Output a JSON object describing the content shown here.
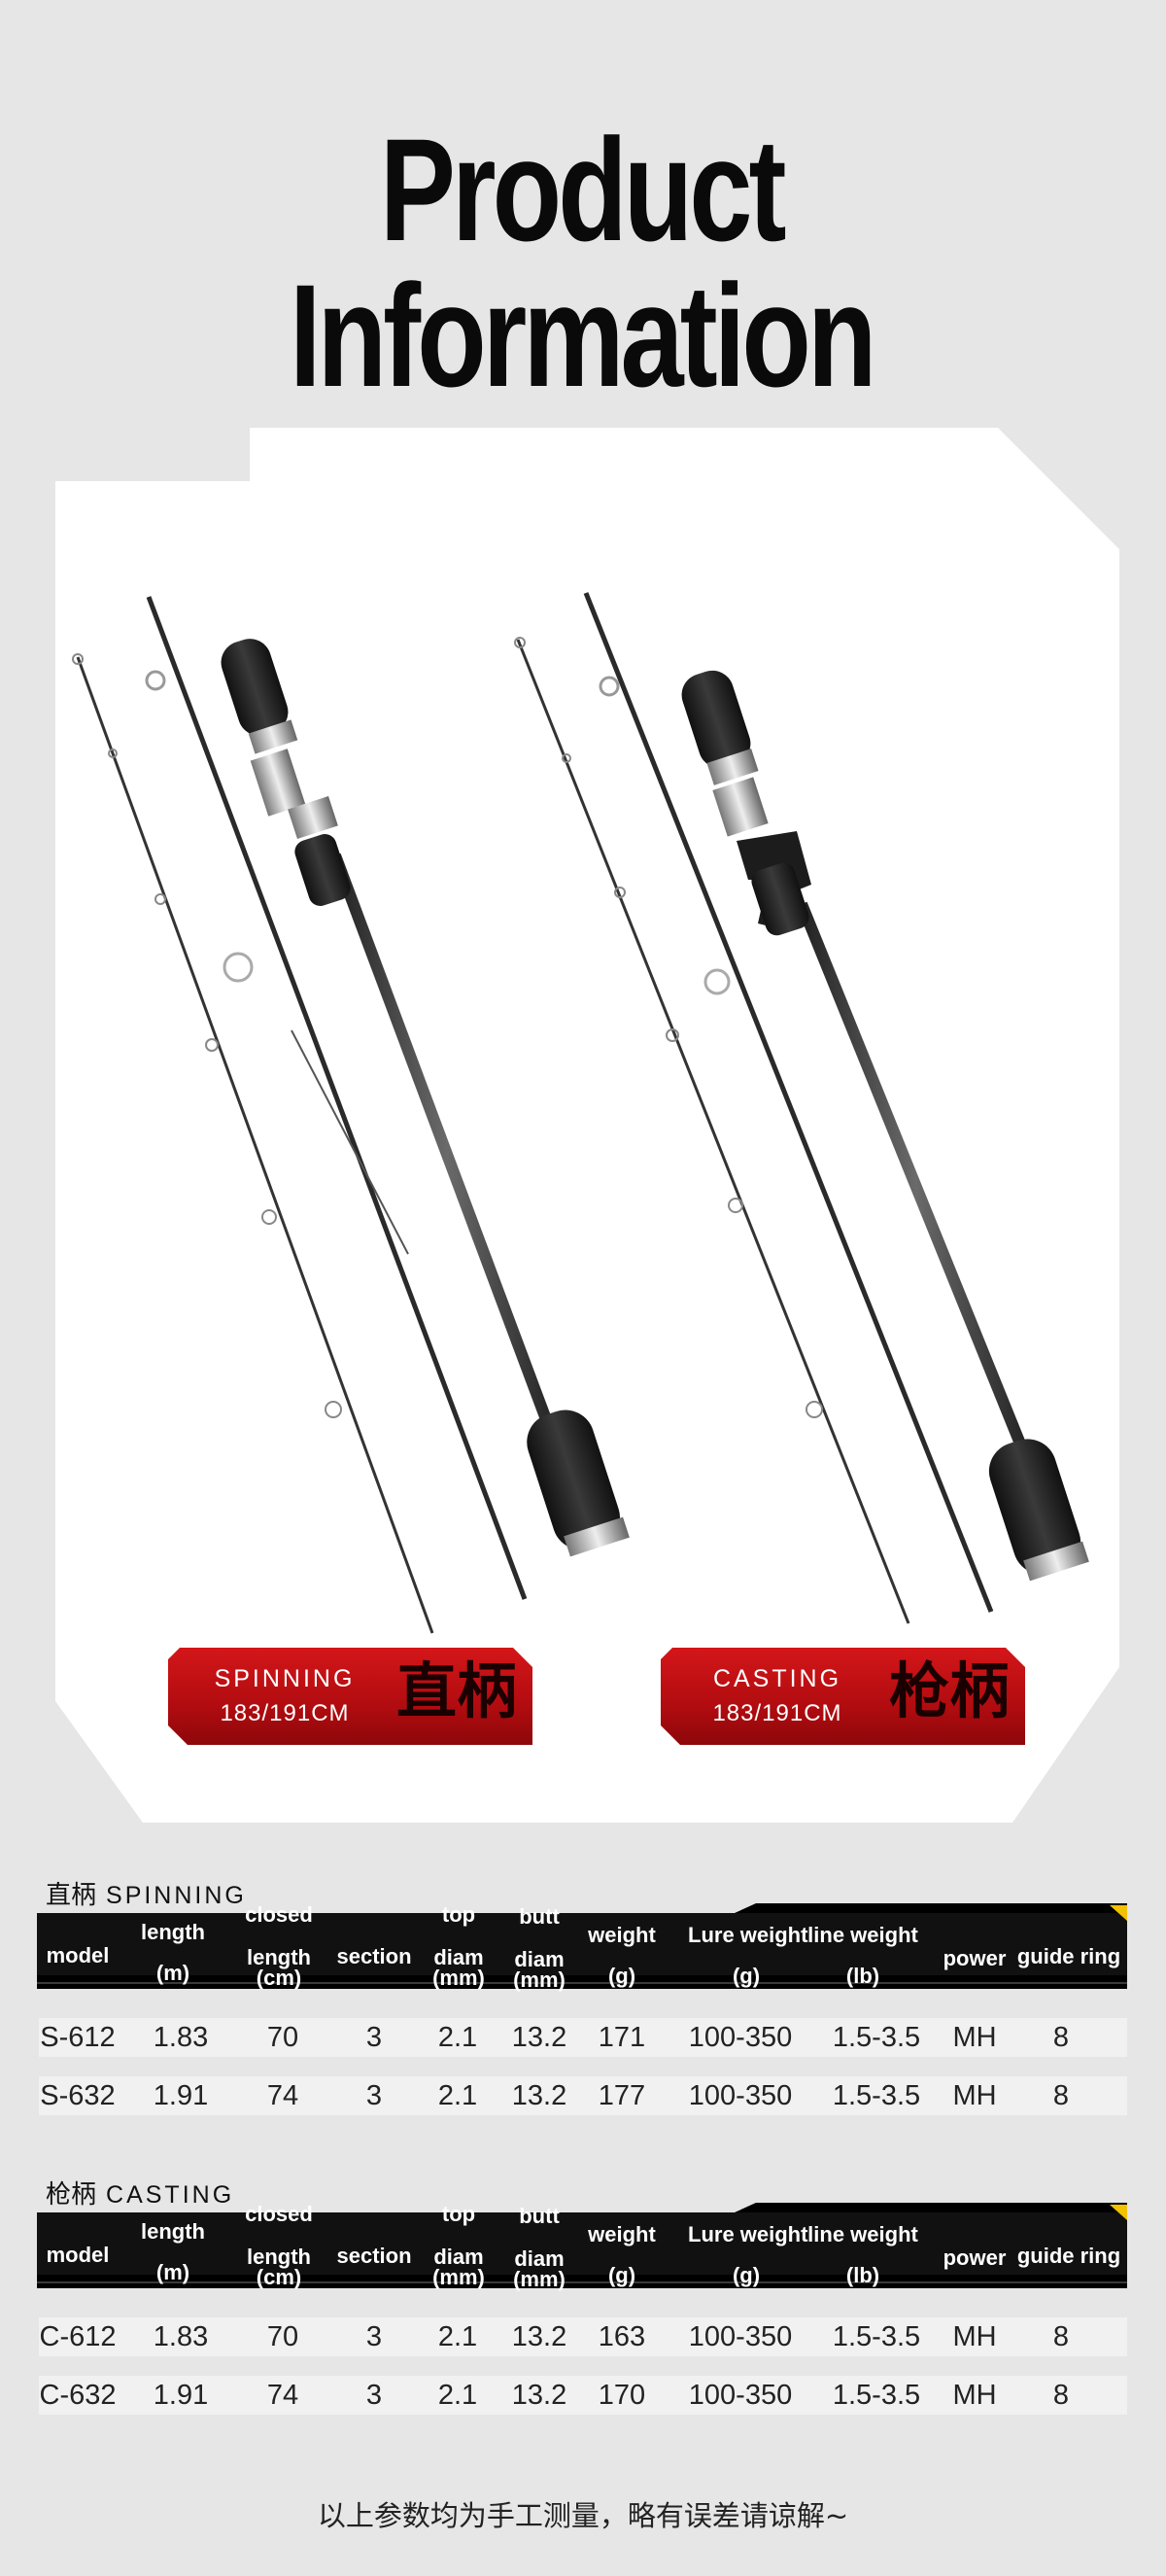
{
  "title": "Product Information",
  "badges": [
    {
      "english": "SPINNING",
      "size": "183/191CM",
      "chinese": "直柄"
    },
    {
      "english": "CASTING",
      "size": "183/191CM",
      "chinese": "枪柄"
    }
  ],
  "headers": {
    "model": "model",
    "length_l1": "length",
    "length_l2": "(m)",
    "closed_l1": "closed",
    "closed_l2": "length",
    "closed_l3": "(cm)",
    "section": "section",
    "top_l1": "top",
    "top_l2": "diam",
    "top_l3": "(mm)",
    "butt_l1": "butt",
    "butt_l2": "diam",
    "butt_l3": "(mm)",
    "weight_l1": "weight",
    "weight_l2": "(g)",
    "lure_l1": "Lure weight",
    "lure_l2": "(g)",
    "line_l1": "line weight",
    "line_l2": "(lb)",
    "power": "power",
    "guide": "guide ring"
  },
  "tables": [
    {
      "label_cn": "直柄",
      "label_en": "SPINNING",
      "rows": [
        {
          "model": "S-612",
          "length": "1.83",
          "closed": "70",
          "section": "3",
          "top": "2.1",
          "butt": "13.2",
          "weight": "171",
          "lure": "100-350",
          "line": "1.5-3.5",
          "power": "MH",
          "guide": "8"
        },
        {
          "model": "S-632",
          "length": "1.91",
          "closed": "74",
          "section": "3",
          "top": "2.1",
          "butt": "13.2",
          "weight": "177",
          "lure": "100-350",
          "line": "1.5-3.5",
          "power": "MH",
          "guide": "8"
        }
      ]
    },
    {
      "label_cn": "枪柄",
      "label_en": "CASTING",
      "rows": [
        {
          "model": "C-612",
          "length": "1.83",
          "closed": "70",
          "section": "3",
          "top": "2.1",
          "butt": "13.2",
          "weight": "163",
          "lure": "100-350",
          "line": "1.5-3.5",
          "power": "MH",
          "guide": "8"
        },
        {
          "model": "C-632",
          "length": "1.91",
          "closed": "74",
          "section": "3",
          "top": "2.1",
          "butt": "13.2",
          "weight": "170",
          "lure": "100-350",
          "line": "1.5-3.5",
          "power": "MH",
          "guide": "8"
        }
      ]
    }
  ],
  "footnote": "以上参数均为手工测量，略有误差请谅解~"
}
